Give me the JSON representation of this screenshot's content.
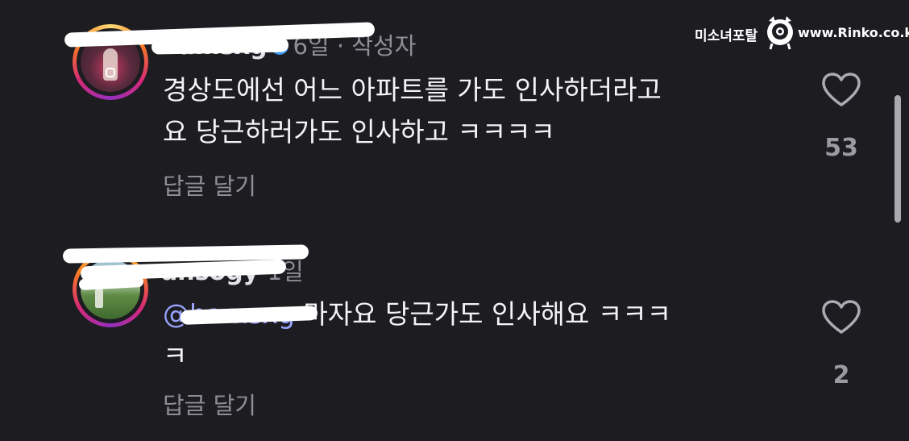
{
  "watermark": {
    "left_text": "미소녀포탈",
    "right_text": "www.Rinko.co.kr"
  },
  "comments": [
    {
      "username": "hamsxg",
      "meta": "6일 · 작성자",
      "text_line1": "경상도에선 어느 아파트를 가도 인사하더라고",
      "text_line2": "요 당근하러가도 인사하고 ㅋㅋㅋㅋ",
      "reply_label": "답글 달기",
      "like_count": "53"
    },
    {
      "username": "ansogy",
      "meta": "1일",
      "mention": "@hamsxg",
      "text_line1": "마자요 당근가도 인사해요 ㅋㅋㅋ",
      "text_line2": "ㅋ",
      "reply_label": "답글 달기",
      "like_count": "2"
    }
  ],
  "colors": {
    "background": "#1c1c21",
    "mention": "#9aa4ff",
    "verified": "#3897f0",
    "muted": "#8e8e96"
  },
  "icons": [
    "heart-outline-icon",
    "verified-badge-icon",
    "instagram-icon"
  ]
}
